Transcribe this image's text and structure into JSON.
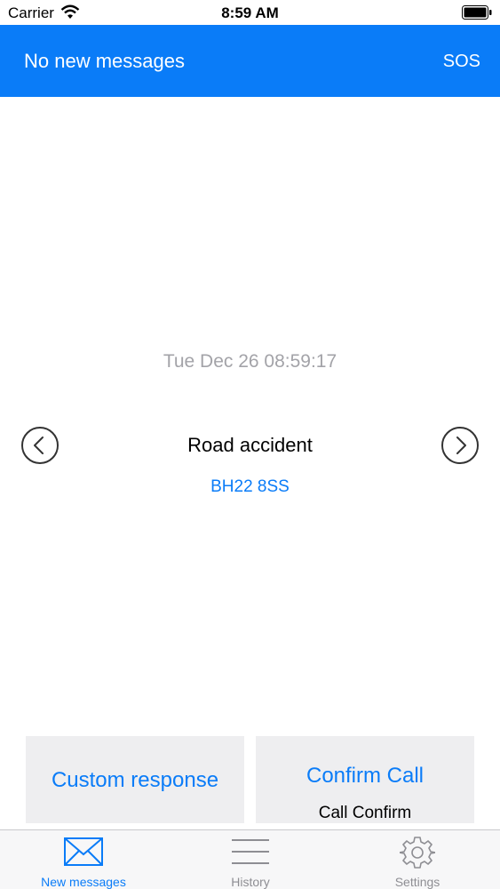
{
  "status_bar": {
    "carrier": "Carrier",
    "time": "8:59 AM"
  },
  "nav": {
    "title": "No new messages",
    "sos_label": "SOS"
  },
  "message": {
    "timestamp": "Tue Dec 26 08:59:17",
    "title": "Road accident",
    "plate": "BH22 8SS"
  },
  "actions": {
    "custom_response": "Custom response",
    "confirm_call": "Confirm Call",
    "confirm_call_sub": "Call Confirm"
  },
  "tabs": [
    {
      "label": "New messages",
      "icon": "envelope-icon",
      "active": true
    },
    {
      "label": "History",
      "icon": "list-icon",
      "active": false
    },
    {
      "label": "Settings",
      "icon": "gear-icon",
      "active": false
    }
  ],
  "colors": {
    "accent": "#0a7cf8",
    "muted": "#a3a3a8",
    "button_bg": "#eeeef0"
  }
}
